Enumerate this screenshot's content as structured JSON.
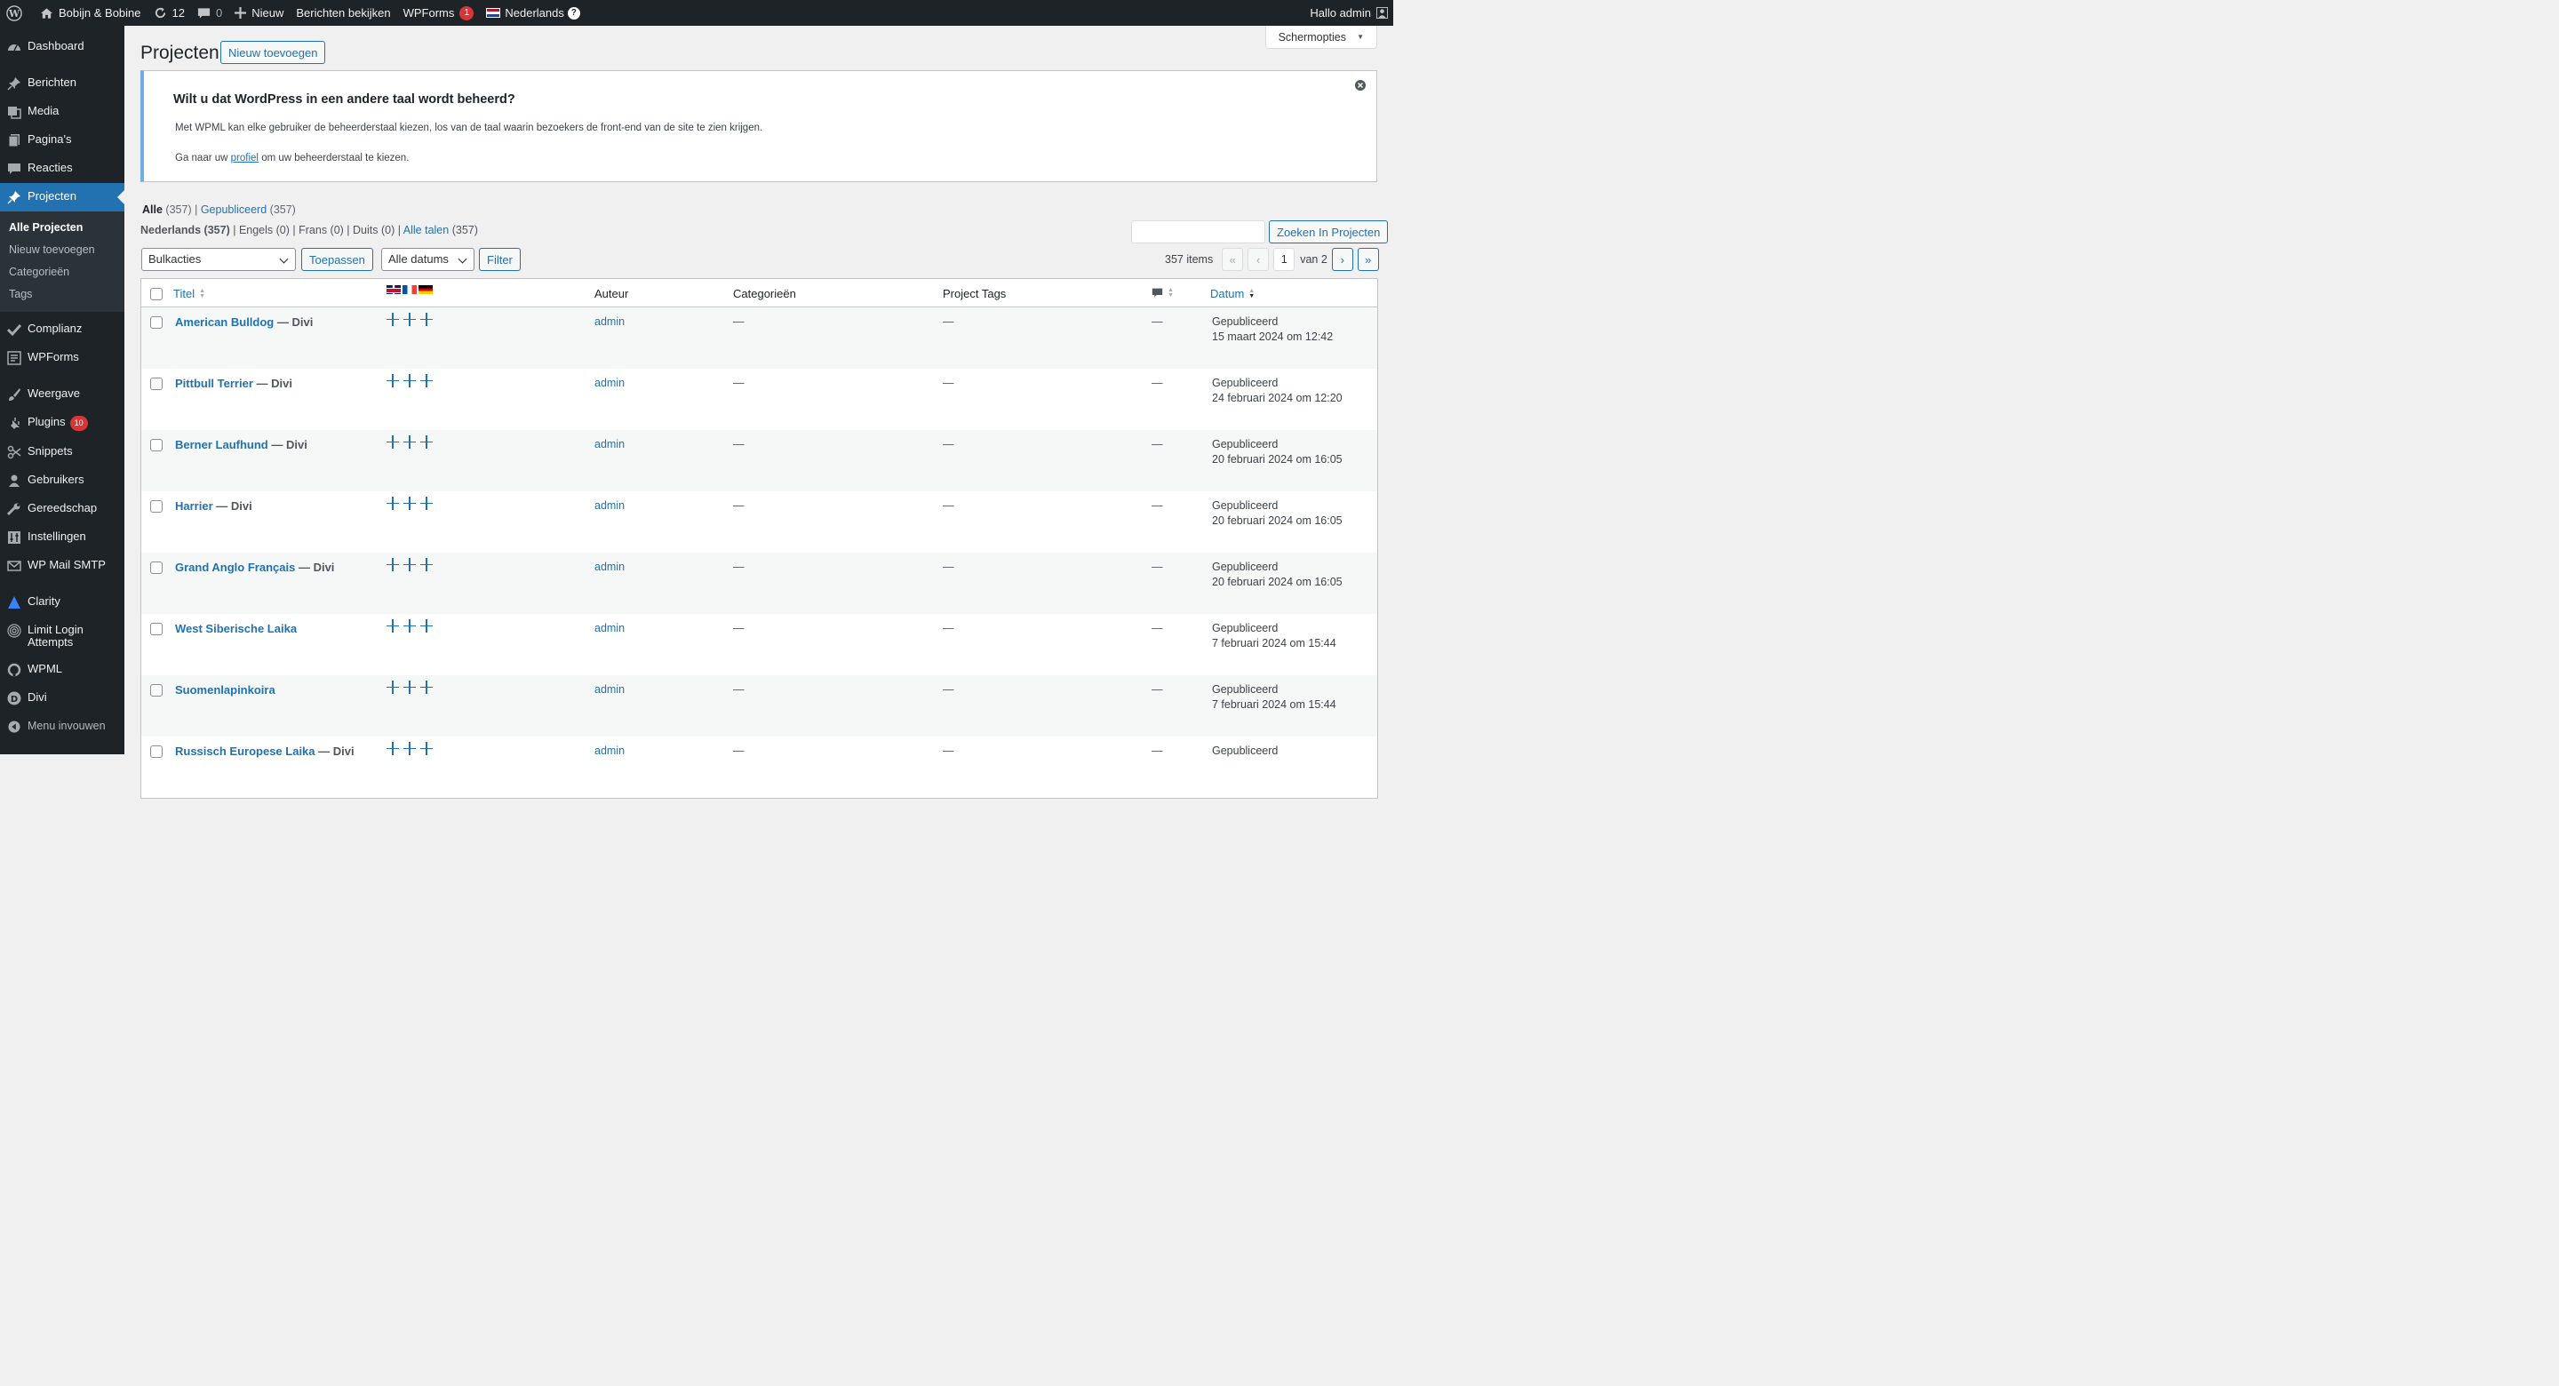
{
  "adminbar": {
    "site_name": "Bobijn & Bobine",
    "updates_count": "12",
    "comments_count": "0",
    "new_label": "Nieuw",
    "view_posts_label": "Berichten bekijken",
    "wpforms_label": "WPForms",
    "wpforms_badge": "1",
    "language_label": "Nederlands",
    "greeting": "Hallo admin"
  },
  "sidebar": {
    "items": [
      {
        "label": "Dashboard",
        "icon": "dashboard-icon"
      },
      {
        "label": "Berichten",
        "icon": "pin-icon"
      },
      {
        "label": "Media",
        "icon": "media-icon"
      },
      {
        "label": "Pagina's",
        "icon": "page-icon"
      },
      {
        "label": "Reacties",
        "icon": "comment-icon"
      },
      {
        "label": "Projecten",
        "icon": "pin-icon"
      },
      {
        "label": "Complianz",
        "icon": "check-icon"
      },
      {
        "label": "WPForms",
        "icon": "form-icon"
      },
      {
        "label": "Weergave",
        "icon": "brush-icon"
      },
      {
        "label": "Plugins",
        "icon": "plugin-icon"
      },
      {
        "label": "Snippets",
        "icon": "scissors-icon"
      },
      {
        "label": "Gebruikers",
        "icon": "user-icon"
      },
      {
        "label": "Gereedschap",
        "icon": "wrench-icon"
      },
      {
        "label": "Instellingen",
        "icon": "settings-icon"
      },
      {
        "label": "WP Mail SMTP",
        "icon": "mail-icon"
      },
      {
        "label": "Clarity",
        "icon": "clarity-icon"
      },
      {
        "label": "Limit Login Attempts",
        "icon": "fingerprint-icon"
      },
      {
        "label": "WPML",
        "icon": "wpml-icon"
      },
      {
        "label": "Divi",
        "icon": "divi-icon"
      }
    ],
    "plugins_badge": "10",
    "submenu": [
      "Alle Projecten",
      "Nieuw toevoegen",
      "Categorieën",
      "Tags"
    ],
    "collapse_label": "Menu invouwen"
  },
  "header": {
    "screen_options": "Schermopties",
    "title": "Projecten",
    "add_new": "Nieuw toevoegen"
  },
  "notice": {
    "heading": "Wilt u dat WordPress in een andere taal wordt beheerd?",
    "line1": "Met WPML kan elke gebruiker de beheerderstaal kiezen, los van de taal waarin bezoekers de front-end van de site te zien krijgen.",
    "line2_before": "Ga naar uw",
    "line2_link": "profiel",
    "line2_after": "om uw beheerderstaal te kiezen."
  },
  "views": {
    "all_label": "Alle",
    "all_count": "(357)",
    "published_label": "Gepubliceerd",
    "published_count": "(357)"
  },
  "languages": {
    "nl": "Nederlands (357)",
    "en": "Engels (0)",
    "fr": "Frans (0)",
    "de": "Duits (0)",
    "all_label": "Alle talen",
    "all_count": "(357)"
  },
  "search": {
    "button": "Zoeken In Projecten",
    "value": ""
  },
  "toolbar": {
    "bulk": "Bulkacties",
    "apply": "Toepassen",
    "dates": "Alle datums",
    "filter": "Filter"
  },
  "pagination": {
    "items": "357 items",
    "current": "1",
    "of": "van 2",
    "first": "«",
    "prev": "‹",
    "next": "›",
    "last": "»"
  },
  "table": {
    "headers": {
      "title": "Titel",
      "author": "Auteur",
      "categories": "Categorieën",
      "tags": "Project Tags",
      "date": "Datum"
    },
    "rows": [
      {
        "title": "American Bulldog",
        "suffix": "— Divi",
        "author": "admin",
        "cat": "—",
        "tags": "—",
        "comments": "—",
        "status": "Gepubliceerd",
        "date": "15 maart 2024 om 12:42"
      },
      {
        "title": "Pittbull Terrier",
        "suffix": "— Divi",
        "author": "admin",
        "cat": "—",
        "tags": "—",
        "comments": "—",
        "status": "Gepubliceerd",
        "date": "24 februari 2024 om 12:20"
      },
      {
        "title": "Berner Laufhund",
        "suffix": "— Divi",
        "author": "admin",
        "cat": "—",
        "tags": "—",
        "comments": "—",
        "status": "Gepubliceerd",
        "date": "20 februari 2024 om 16:05"
      },
      {
        "title": "Harrier",
        "suffix": "— Divi",
        "author": "admin",
        "cat": "—",
        "tags": "—",
        "comments": "—",
        "status": "Gepubliceerd",
        "date": "20 februari 2024 om 16:05"
      },
      {
        "title": "Grand Anglo Français",
        "suffix": "— Divi",
        "author": "admin",
        "cat": "—",
        "tags": "—",
        "comments": "—",
        "status": "Gepubliceerd",
        "date": "20 februari 2024 om 16:05"
      },
      {
        "title": "West Siberische Laika",
        "suffix": "",
        "author": "admin",
        "cat": "—",
        "tags": "—",
        "comments": "—",
        "status": "Gepubliceerd",
        "date": "7 februari 2024 om 15:44"
      },
      {
        "title": "Suomenlapinkoira",
        "suffix": "",
        "author": "admin",
        "cat": "—",
        "tags": "—",
        "comments": "—",
        "status": "Gepubliceerd",
        "date": "7 februari 2024 om 15:44"
      },
      {
        "title": "Russisch Europese Laika",
        "suffix": "— Divi",
        "author": "admin",
        "cat": "—",
        "tags": "—",
        "comments": "—",
        "status": "Gepubliceerd",
        "date": ""
      }
    ]
  },
  "colors": {
    "accent": "#2271b1",
    "adminbar": "#1d2327",
    "badge": "#d63638"
  }
}
